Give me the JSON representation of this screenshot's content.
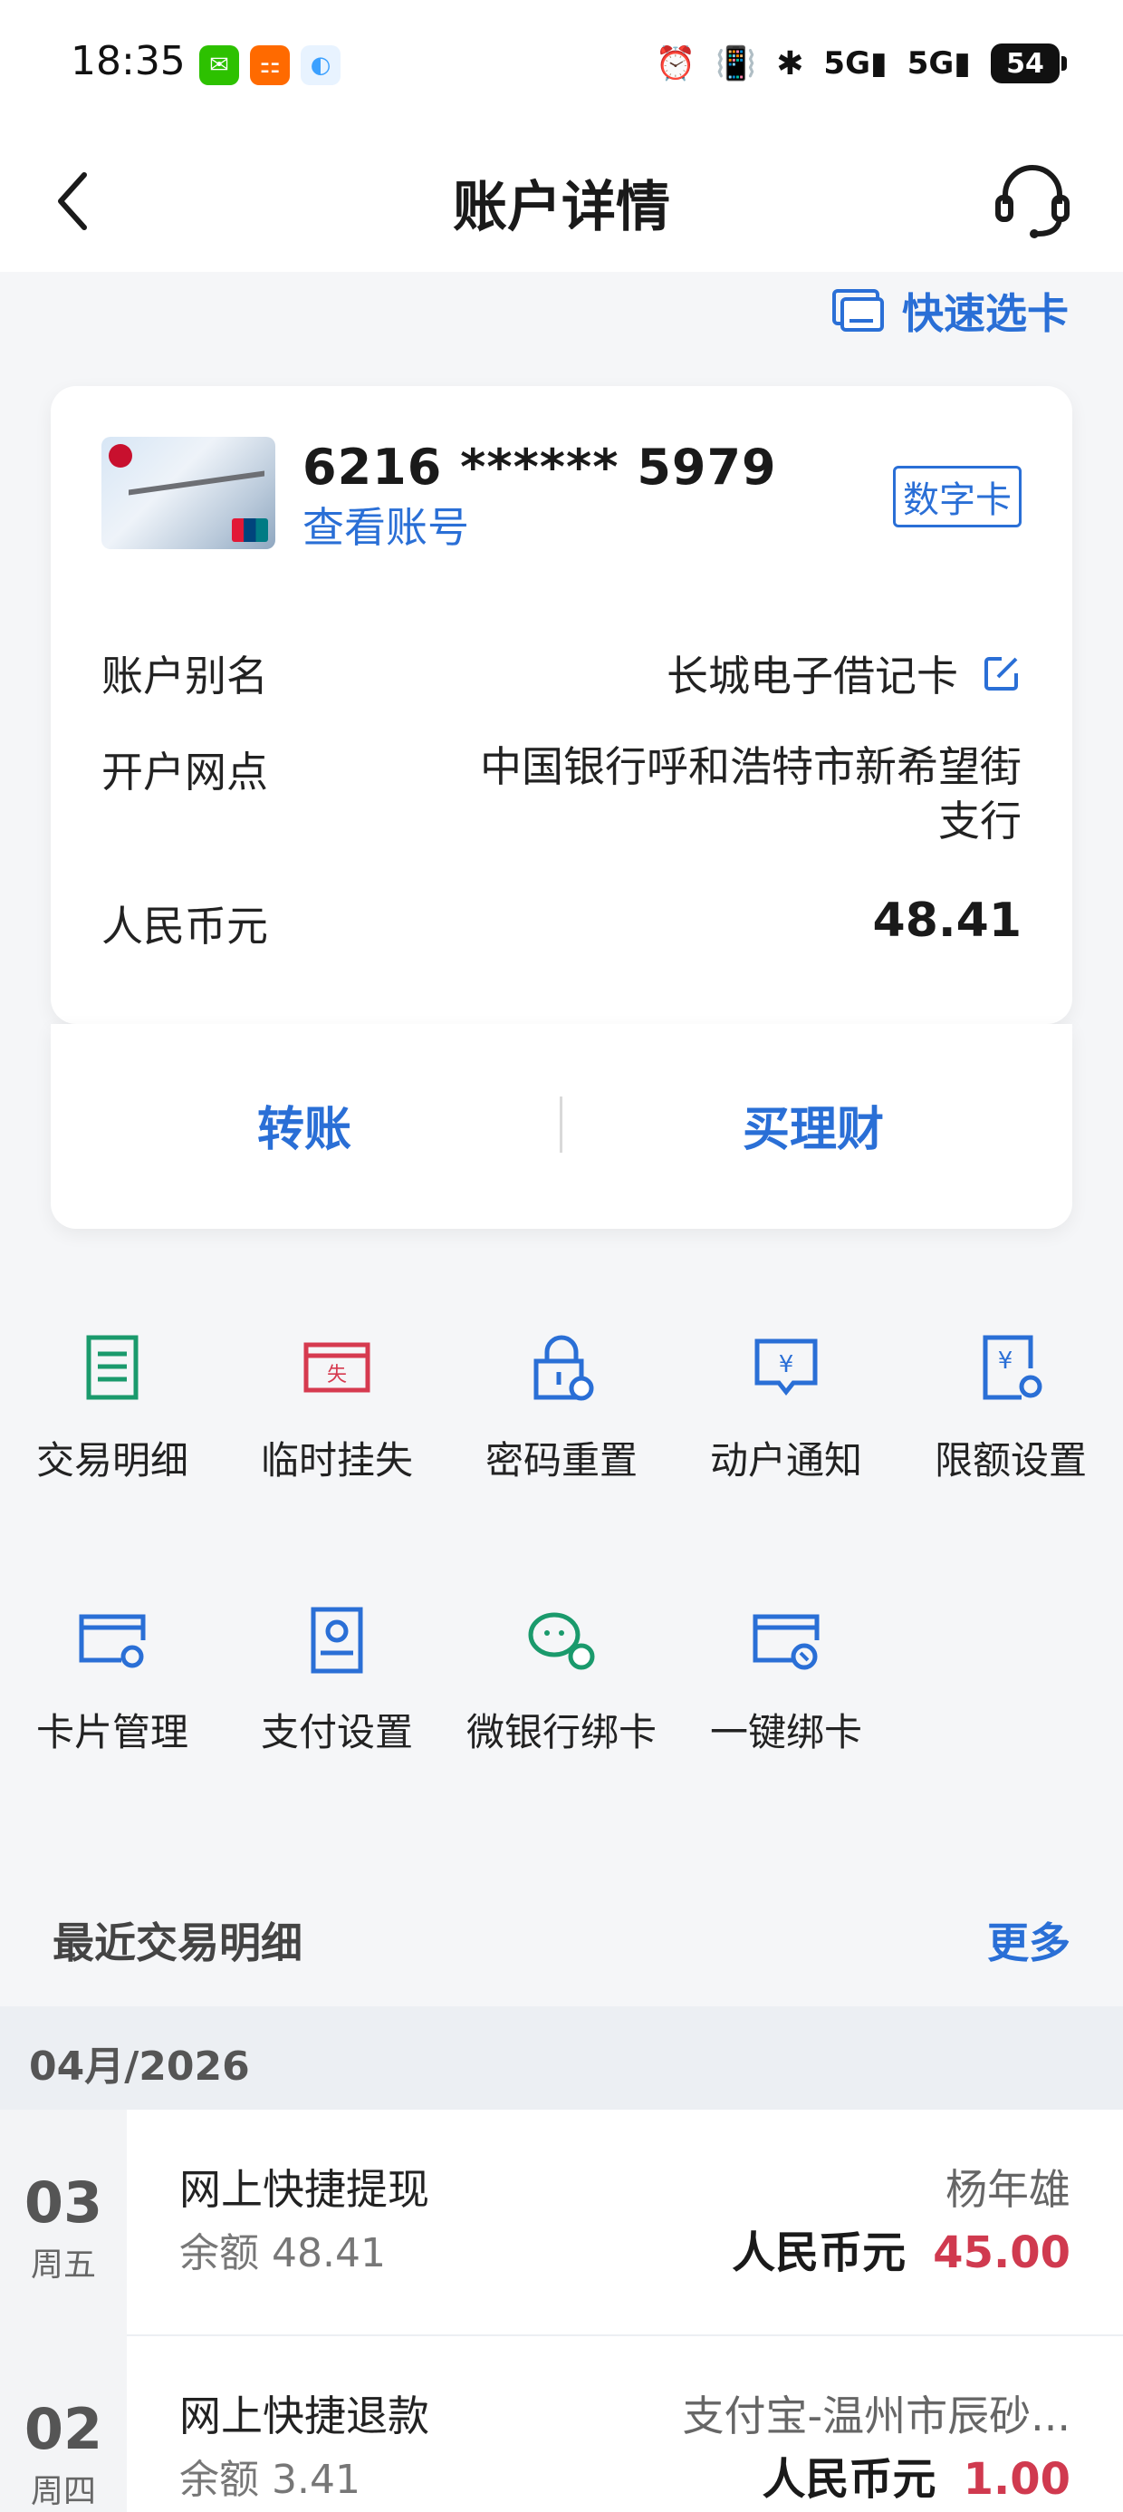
{
  "status_bar": {
    "time": "18:35",
    "apps": [
      {
        "name": "wechat-app-icon",
        "color": "#2dc100",
        "glyph": "✉"
      },
      {
        "name": "app-icon",
        "color": "#ff6a00",
        "glyph": "⚏"
      },
      {
        "name": "browser-app-icon",
        "color": "#3ba0ff",
        "glyph": "◐"
      }
    ],
    "network_1": "5G",
    "network_2": "5G",
    "battery": "54"
  },
  "header": {
    "title": "账户详情"
  },
  "quick_pick_label": "快速选卡",
  "account": {
    "card_number": "6216 ****** 5979",
    "view_number_label": "查看账号",
    "badge": "数字卡",
    "alias_label": "账户别名",
    "alias_value": "长城电子借记卡",
    "branch_label": "开户网点",
    "branch_value": "中国银行呼和浩特市新希望街支行",
    "currency_label": "人民币元",
    "balance": "48.41"
  },
  "actions": {
    "transfer": "转账",
    "wealth": "买理财"
  },
  "functions": [
    {
      "label": "交易明细",
      "icon": "transaction-list-icon",
      "color": "#1a9a6c"
    },
    {
      "label": "临时挂失",
      "icon": "report-loss-icon",
      "color": "#d63a4f"
    },
    {
      "label": "密码重置",
      "icon": "password-reset-icon",
      "color": "#2a6fd6"
    },
    {
      "label": "动户通知",
      "icon": "account-notice-icon",
      "color": "#2a6fd6"
    },
    {
      "label": "限额设置",
      "icon": "limit-settings-icon",
      "color": "#2a6fd6"
    },
    {
      "label": "卡片管理",
      "icon": "card-management-icon",
      "color": "#2a6fd6"
    },
    {
      "label": "支付设置",
      "icon": "payment-settings-icon",
      "color": "#2a6fd6"
    },
    {
      "label": "微银行绑卡",
      "icon": "wechat-bind-icon",
      "color": "#1a9a6c"
    },
    {
      "label": "一键绑卡",
      "icon": "one-click-bind-icon",
      "color": "#2a6fd6"
    }
  ],
  "recent": {
    "title": "最近交易明细",
    "more": "更多",
    "month": "04月/2026",
    "transactions": [
      {
        "day": "03",
        "weekday": "周五",
        "name": "网上快捷提现",
        "balance": "余额 48.41",
        "party": "杨年雄",
        "currency": "人民币元",
        "amount": "45.00"
      },
      {
        "day": "02",
        "weekday": "周四",
        "name": "网上快捷退款",
        "balance": "余额 3.41",
        "party": "支付宝-温州市辰砂...",
        "currency": "人民币元",
        "amount": "1.00"
      }
    ]
  },
  "colors": {
    "accent": "#2a6fd6",
    "negative": "#d03a4f",
    "green": "#1a9a6c"
  }
}
